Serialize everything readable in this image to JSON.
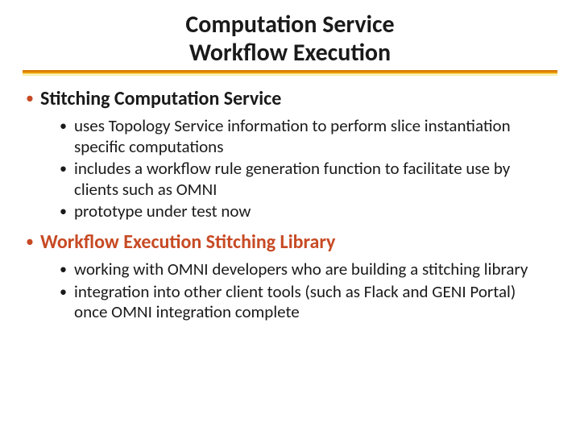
{
  "title": {
    "line1": "Computation Service",
    "line2": "Workflow Execution"
  },
  "items": [
    {
      "heading": "Stitching Computation Service",
      "accent": false,
      "sub": [
        "uses Topology Service information to perform slice instantiation specific computations",
        "includes a workflow rule generation function to facilitate use by clients such as OMNI",
        "prototype under test now"
      ]
    },
    {
      "heading": "Workflow Execution Stitching Library",
      "accent": true,
      "sub": [
        "working with OMNI developers who are building a stitching library",
        "integration into other client tools (such as Flack and GENI Portal) once OMNI integration complete"
      ]
    }
  ]
}
